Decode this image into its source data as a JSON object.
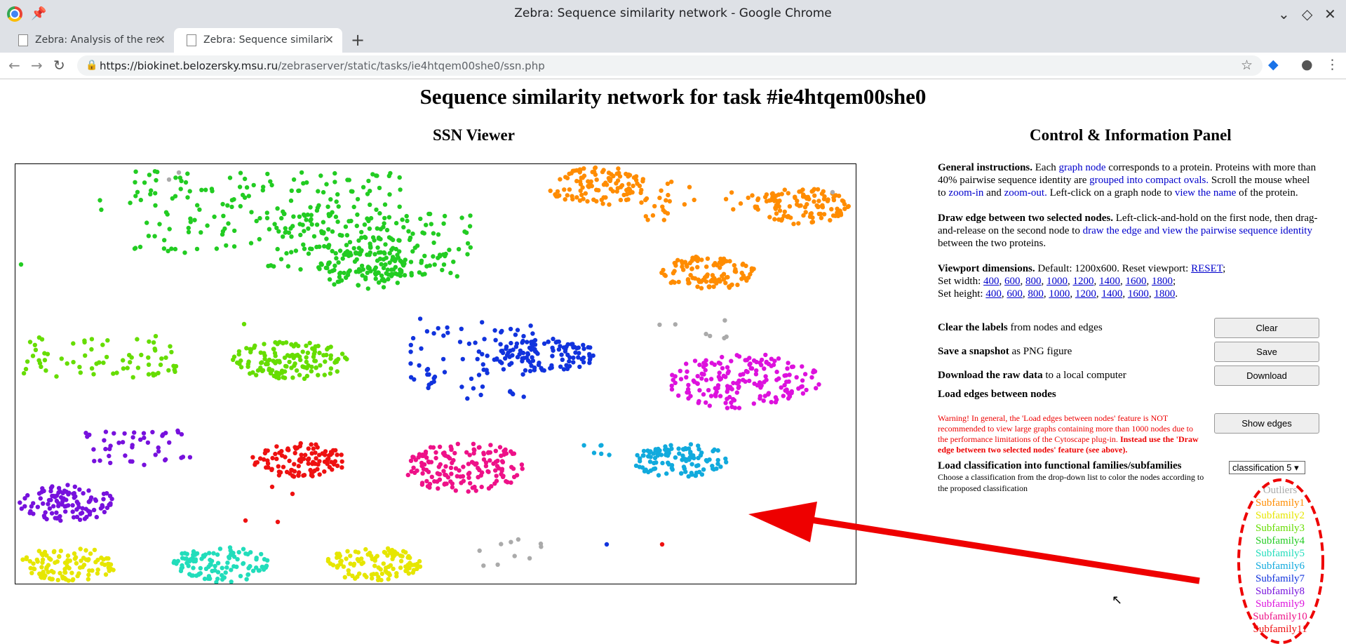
{
  "window": {
    "title": "Zebra: Sequence similarity network - Google Chrome"
  },
  "tabs": [
    {
      "label": "Zebra: Analysis of the results"
    },
    {
      "label": "Zebra: Sequence similarity ne"
    }
  ],
  "url": {
    "host": "https://biokinet.belozersky.msu.ru",
    "path": "/zebraserver/static/tasks/ie4htqem00she0/ssn.php"
  },
  "page": {
    "title": "Sequence similarity network for task #ie4htqem00she0",
    "viewer_title": "SSN Viewer",
    "panel_title": "Control & Information Panel"
  },
  "instructions": {
    "general_head": "General instructions.",
    "general_1": "Each",
    "general_link1": "graph node",
    "general_2": "corresponds to a protein. Proteins with more than 40% pairwise sequence identity are",
    "general_link2": "grouped into compact ovals.",
    "general_3": "Scroll the mouse wheel to",
    "general_link3": "zoom-in",
    "general_4": "and",
    "general_link4": "zoom-out.",
    "general_5": "Left-click on a graph node to",
    "general_link5": "view the name",
    "general_6": "of the protein.",
    "edge_head": "Draw edge between two selected nodes.",
    "edge_1": "Left-click-and-hold on the first node, then drag-and-release on the second node to",
    "edge_link": "draw the edge and view the pairwise sequence identity",
    "edge_2": "between the two proteins.",
    "vp_head": "Viewport dimensions.",
    "vp_1": "Default: 1200x600. Reset viewport:",
    "vp_reset": "RESET",
    "vp_width": "Set width:",
    "vp_height": "Set height:",
    "sizes": [
      "400",
      "600",
      "800",
      "1000",
      "1200",
      "1400",
      "1600",
      "1800"
    ]
  },
  "actions": {
    "clear_head": "Clear the labels",
    "clear_rest": "from nodes and edges",
    "clear_btn": "Clear",
    "save_head": "Save a snapshot",
    "save_rest": "as PNG figure",
    "save_btn": "Save",
    "download_head": "Download the raw data",
    "download_rest": "to a local computer",
    "download_btn": "Download",
    "load_edges_head": "Load edges between nodes",
    "warning_1": "Warning! In general, the 'Load edges between nodes' feature is NOT recommended to view large graphs containing more than 1000 nodes due to the performance limitations of the Cytoscape plug-in.",
    "warning_2": "Instead use the 'Draw edge between two selected nodes' feature (see above).",
    "show_edges_btn": "Show edges",
    "classification_head": "Load classification into functional families/subfamilies",
    "classification_note": "Choose a classification from the drop-down list to color the nodes according to the proposed classification",
    "classification_selected": "classification 5 ▾"
  },
  "legend": [
    {
      "label": "Outliers",
      "color": "#aaaaaa"
    },
    {
      "label": "Subfamily1",
      "color": "#ff8c00"
    },
    {
      "label": "Subfamily2",
      "color": "#e6e600"
    },
    {
      "label": "Subfamily3",
      "color": "#66dd00"
    },
    {
      "label": "Subfamily4",
      "color": "#22cc22"
    },
    {
      "label": "Subfamily5",
      "color": "#22ddbb"
    },
    {
      "label": "Subfamily6",
      "color": "#11aadd"
    },
    {
      "label": "Subfamily7",
      "color": "#1133dd"
    },
    {
      "label": "Subfamily8",
      "color": "#7711dd"
    },
    {
      "label": "Subfamily9",
      "color": "#dd11dd"
    },
    {
      "label": "Subfamily10",
      "color": "#ee1188"
    },
    {
      "label": "Subfamily11",
      "color": "#ee1111"
    }
  ]
}
